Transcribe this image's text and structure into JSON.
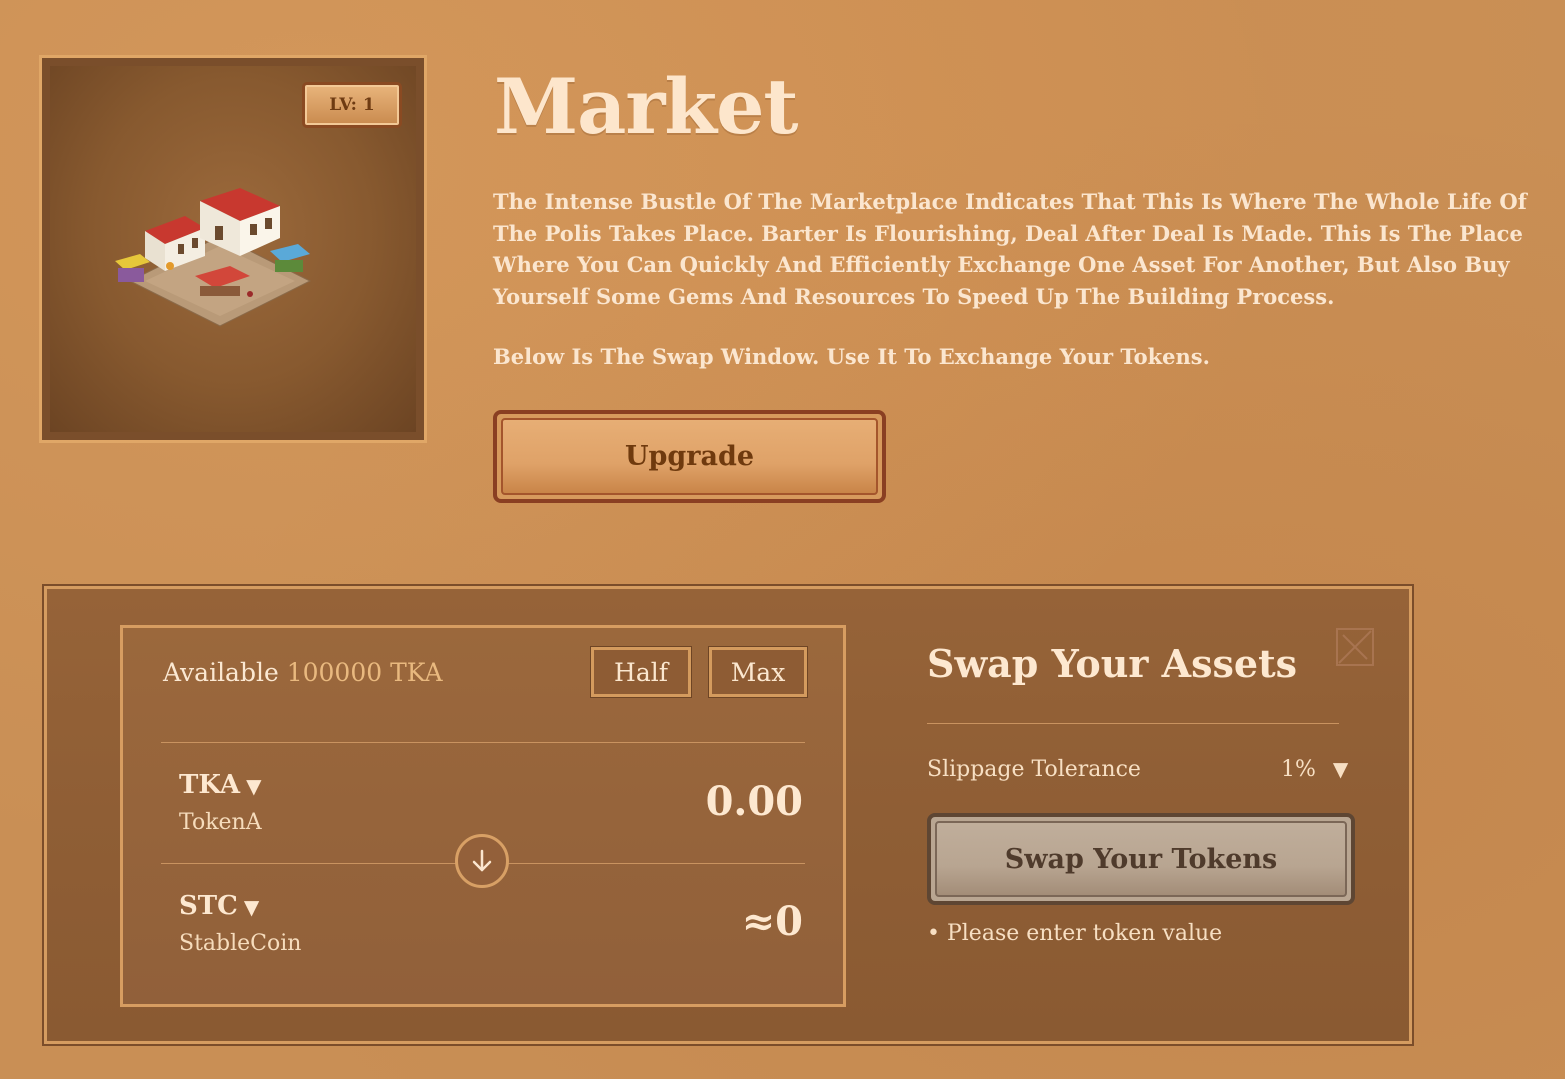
{
  "building": {
    "level_label": "LV: 1",
    "title": "Market",
    "description": "The Intense Bustle Of The Marketplace Indicates That This Is Where The Whole Life Of The Polis Takes Place. Barter Is Flourishing, Deal After Deal Is Made. This Is The Place Where You Can Quickly And Efficiently Exchange One Asset For Another, But Also Buy Yourself Some Gems And Resources To Speed Up The Building Process.",
    "swap_hint": "Below Is The Swap Window. Use It To Exchange Your Tokens.",
    "upgrade_label": "Upgrade"
  },
  "swap": {
    "available_prefix": "Available",
    "available_amount": "100000 TKA",
    "half_label": "Half",
    "max_label": "Max",
    "from": {
      "symbol": "TKA",
      "name": "TokenA",
      "amount": "0.00"
    },
    "to": {
      "symbol": "STC",
      "name": "StableCoin",
      "amount": "≈0"
    },
    "heading": "Swap Your Assets",
    "slippage_label": "Slippage Tolerance",
    "slippage_value": "1%",
    "swap_button_label": "Swap Your Tokens",
    "validation_message": "• Please enter token value"
  },
  "colors": {
    "background": "#c98f55",
    "panel": "#8f5e35",
    "accent": "#e9b97f",
    "button_text": "#6f3a0e"
  }
}
